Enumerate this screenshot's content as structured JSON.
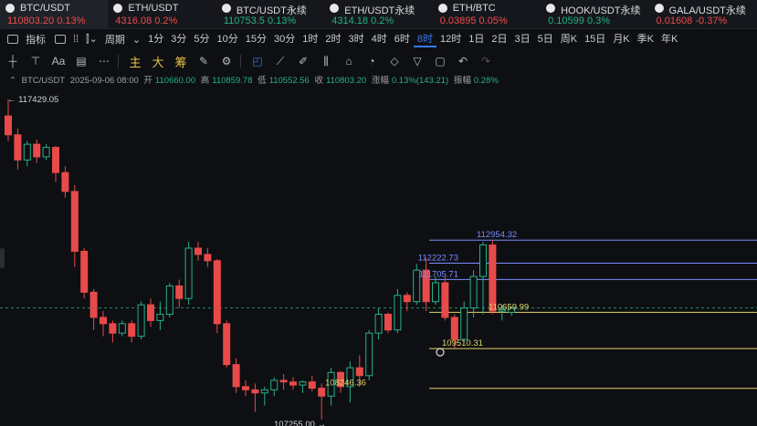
{
  "tickers": [
    {
      "name": "BTC/USDT",
      "price": "110803.20",
      "change": "0.13%",
      "dir": "down",
      "active": true
    },
    {
      "name": "ETH/USDT",
      "price": "4316.08",
      "change": "0.2%",
      "dir": "down"
    },
    {
      "name": "BTC/USDT永续",
      "price": "110753.5",
      "change": "0.13%",
      "dir": "up"
    },
    {
      "name": "ETH/USDT永续",
      "price": "4314.18",
      "change": "0.2%",
      "dir": "up"
    },
    {
      "name": "ETH/BTC",
      "price": "0.03895",
      "change": "0.05%",
      "dir": "down"
    },
    {
      "name": "HOOK/USDT永续",
      "price": "0.10599",
      "change": "0.3%",
      "dir": "up"
    },
    {
      "name": "GALA/USDT永续",
      "price": "0.01608",
      "change": "-0.37%",
      "dir": "down"
    }
  ],
  "periods": {
    "indicator": "指标",
    "cycle": "周期",
    "items": [
      "1分",
      "3分",
      "5分",
      "10分",
      "15分",
      "30分",
      "1时",
      "2时",
      "3时",
      "4时",
      "6时",
      "8时",
      "12时",
      "1日",
      "2日",
      "3日",
      "5日",
      "周K",
      "15日",
      "月K",
      "季K",
      "年K"
    ],
    "selected": "8时"
  },
  "tools": {
    "zhu": "主",
    "da": "大",
    "chou": "筹",
    "text": "Aa"
  },
  "info": {
    "symbol": "BTC/USDT",
    "datetime": "2025-09-06 08:00",
    "open_label": "开",
    "open": "110660.00",
    "high_label": "高",
    "high": "110859.78",
    "low_label": "低",
    "low": "110552.56",
    "close_label": "收",
    "close": "110803.20",
    "change_label": "涨幅",
    "change": "0.13%(143.21)",
    "amp_label": "振幅",
    "amp": "0.28%"
  },
  "chart_data": {
    "type": "candlestick",
    "annotations": {
      "high_label": "117429.05",
      "low_label": "107255.00",
      "levels": [
        {
          "value": 112954.32,
          "label": "112954.32",
          "color": "#7a8cff"
        },
        {
          "value": 112222.73,
          "label": "112222.73",
          "color": "#7a8cff"
        },
        {
          "value": 111705.71,
          "label": "111705.71",
          "color": "#7a8cff"
        },
        {
          "value": 110659.99,
          "label": "110659.99",
          "color": "#e0d46a"
        },
        {
          "value": 109510.31,
          "label": "109510.31",
          "color": "#e0d46a"
        },
        {
          "value": 108246.36,
          "label": "108246.36",
          "color": "#e0d46a"
        }
      ],
      "current_price": 110803.2
    },
    "candles": [
      {
        "o": 116900,
        "h": 117429.05,
        "l": 116100,
        "c": 116300
      },
      {
        "o": 116300,
        "h": 116500,
        "l": 115200,
        "c": 115500
      },
      {
        "o": 115500,
        "h": 116100,
        "l": 115300,
        "c": 116000
      },
      {
        "o": 116000,
        "h": 116150,
        "l": 115400,
        "c": 115600
      },
      {
        "o": 115600,
        "h": 116000,
        "l": 115500,
        "c": 115900
      },
      {
        "o": 115900,
        "h": 115950,
        "l": 114800,
        "c": 115100
      },
      {
        "o": 115100,
        "h": 115300,
        "l": 114300,
        "c": 114500
      },
      {
        "o": 114500,
        "h": 114700,
        "l": 112100,
        "c": 112600
      },
      {
        "o": 112600,
        "h": 112700,
        "l": 111100,
        "c": 111300
      },
      {
        "o": 111300,
        "h": 111400,
        "l": 110100,
        "c": 110500
      },
      {
        "o": 110500,
        "h": 110700,
        "l": 109900,
        "c": 110300
      },
      {
        "o": 110300,
        "h": 110400,
        "l": 109700,
        "c": 110000
      },
      {
        "o": 110000,
        "h": 110400,
        "l": 109900,
        "c": 110300
      },
      {
        "o": 110300,
        "h": 110400,
        "l": 109700,
        "c": 109900
      },
      {
        "o": 109900,
        "h": 111000,
        "l": 109800,
        "c": 110900
      },
      {
        "o": 110900,
        "h": 111100,
        "l": 110200,
        "c": 110400
      },
      {
        "o": 110400,
        "h": 111000,
        "l": 110100,
        "c": 110600
      },
      {
        "o": 110600,
        "h": 111600,
        "l": 110500,
        "c": 111500
      },
      {
        "o": 111500,
        "h": 111700,
        "l": 110800,
        "c": 111100
      },
      {
        "o": 111100,
        "h": 112900,
        "l": 110900,
        "c": 112700
      },
      {
        "o": 112700,
        "h": 112900,
        "l": 112300,
        "c": 112500
      },
      {
        "o": 112500,
        "h": 112700,
        "l": 112100,
        "c": 112300
      },
      {
        "o": 112300,
        "h": 112350,
        "l": 110000,
        "c": 110300
      },
      {
        "o": 110300,
        "h": 110400,
        "l": 108900,
        "c": 109000
      },
      {
        "o": 109000,
        "h": 109200,
        "l": 108100,
        "c": 108300
      },
      {
        "o": 108300,
        "h": 108500,
        "l": 108000,
        "c": 108200
      },
      {
        "o": 108200,
        "h": 108400,
        "l": 107500,
        "c": 108100
      },
      {
        "o": 108100,
        "h": 108300,
        "l": 107700,
        "c": 108200
      },
      {
        "o": 108200,
        "h": 108600,
        "l": 108000,
        "c": 108500
      },
      {
        "o": 108500,
        "h": 108700,
        "l": 108200,
        "c": 108450
      },
      {
        "o": 108450,
        "h": 108600,
        "l": 108200,
        "c": 108350
      },
      {
        "o": 108350,
        "h": 108500,
        "l": 108100,
        "c": 108450
      },
      {
        "o": 108450,
        "h": 108650,
        "l": 108150,
        "c": 108250
      },
      {
        "o": 108250,
        "h": 108400,
        "l": 107255,
        "c": 108000
      },
      {
        "o": 108000,
        "h": 108900,
        "l": 107700,
        "c": 108750
      },
      {
        "o": 108750,
        "h": 108800,
        "l": 108100,
        "c": 108300
      },
      {
        "o": 108300,
        "h": 109100,
        "l": 107800,
        "c": 108900
      },
      {
        "o": 108900,
        "h": 109300,
        "l": 108300,
        "c": 108650
      },
      {
        "o": 108650,
        "h": 110100,
        "l": 108500,
        "c": 110000
      },
      {
        "o": 110000,
        "h": 110800,
        "l": 109800,
        "c": 110600
      },
      {
        "o": 110600,
        "h": 110650,
        "l": 110000,
        "c": 110100
      },
      {
        "o": 110100,
        "h": 111400,
        "l": 110000,
        "c": 111200
      },
      {
        "o": 111200,
        "h": 111300,
        "l": 110700,
        "c": 111000
      },
      {
        "o": 111000,
        "h": 112200,
        "l": 110900,
        "c": 112000
      },
      {
        "o": 112000,
        "h": 112400,
        "l": 110700,
        "c": 111000
      },
      {
        "o": 111000,
        "h": 111800,
        "l": 110900,
        "c": 111600
      },
      {
        "o": 111600,
        "h": 111800,
        "l": 110400,
        "c": 110500
      },
      {
        "o": 110500,
        "h": 110600,
        "l": 109510.31,
        "c": 109800
      },
      {
        "o": 109800,
        "h": 111000,
        "l": 109700,
        "c": 110800
      },
      {
        "o": 110800,
        "h": 112000,
        "l": 110500,
        "c": 111800
      },
      {
        "o": 111800,
        "h": 112900,
        "l": 110600,
        "c": 112800
      },
      {
        "o": 112800,
        "h": 112954.32,
        "l": 110600,
        "c": 110700
      },
      {
        "o": 110700,
        "h": 110900,
        "l": 110400,
        "c": 110750
      },
      {
        "o": 110660,
        "h": 110859.78,
        "l": 110552.56,
        "c": 110803.2
      }
    ]
  }
}
